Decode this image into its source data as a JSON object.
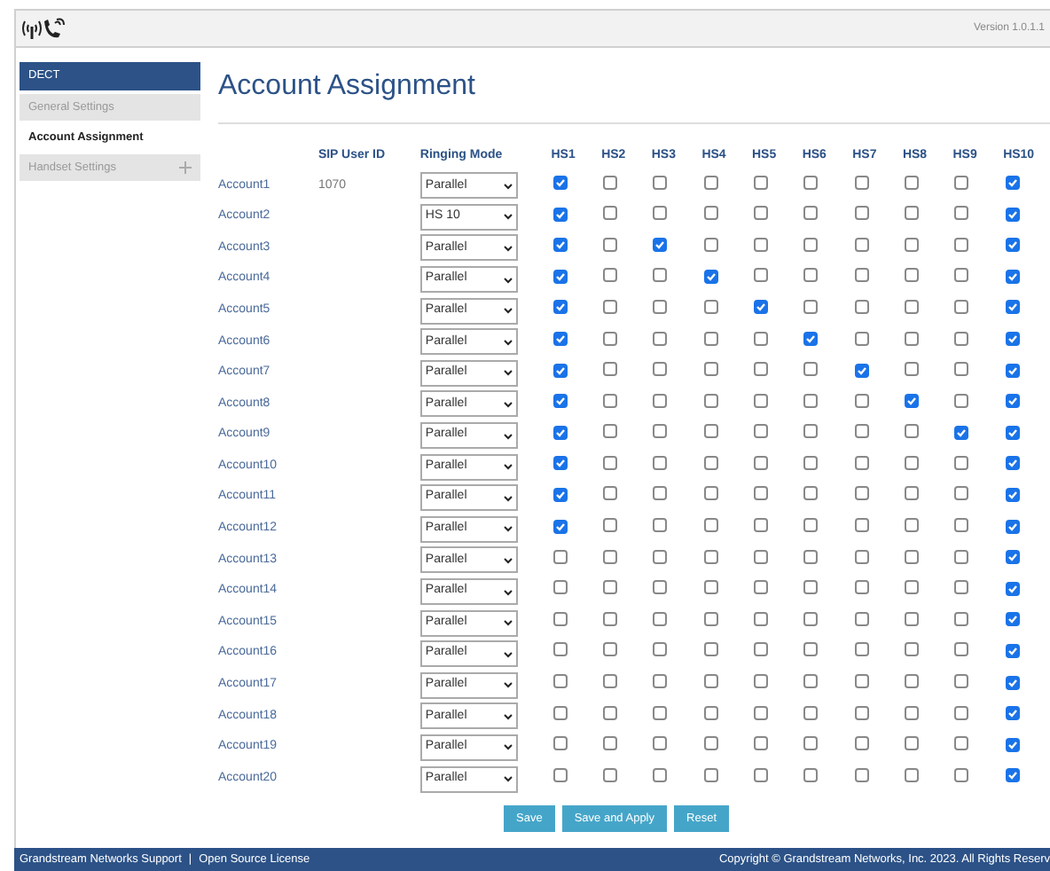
{
  "header": {
    "version": "Version 1.0.1.1"
  },
  "sidebar": {
    "section": "DECT",
    "items": [
      {
        "label": "General Settings",
        "selected": false,
        "expandable": false
      },
      {
        "label": "Account Assignment",
        "selected": true,
        "expandable": false
      },
      {
        "label": "Handset Settings",
        "selected": false,
        "expandable": true
      }
    ]
  },
  "page": {
    "title": "Account Assignment"
  },
  "table": {
    "columns": [
      "SIP User ID",
      "Ringing Mode"
    ],
    "handsets": [
      "HS1",
      "HS2",
      "HS3",
      "HS4",
      "HS5",
      "HS6",
      "HS7",
      "HS8",
      "HS9",
      "HS10"
    ],
    "rows": [
      {
        "account": "Account1",
        "sip_user_id": "1070",
        "ringing_mode": "Parallel",
        "hs": [
          true,
          false,
          false,
          false,
          false,
          false,
          false,
          false,
          false,
          true
        ]
      },
      {
        "account": "Account2",
        "ringing_mode": "HS 10",
        "hs": [
          true,
          false,
          false,
          false,
          false,
          false,
          false,
          false,
          false,
          true
        ]
      },
      {
        "account": "Account3",
        "ringing_mode": "Parallel",
        "hs": [
          true,
          false,
          true,
          false,
          false,
          false,
          false,
          false,
          false,
          true
        ]
      },
      {
        "account": "Account4",
        "ringing_mode": "Parallel",
        "hs": [
          true,
          false,
          false,
          true,
          false,
          false,
          false,
          false,
          false,
          true
        ]
      },
      {
        "account": "Account5",
        "ringing_mode": "Parallel",
        "hs": [
          true,
          false,
          false,
          false,
          true,
          false,
          false,
          false,
          false,
          true
        ]
      },
      {
        "account": "Account6",
        "ringing_mode": "Parallel",
        "hs": [
          true,
          false,
          false,
          false,
          false,
          true,
          false,
          false,
          false,
          true
        ]
      },
      {
        "account": "Account7",
        "ringing_mode": "Parallel",
        "hs": [
          true,
          false,
          false,
          false,
          false,
          false,
          true,
          false,
          false,
          true
        ]
      },
      {
        "account": "Account8",
        "ringing_mode": "Parallel",
        "hs": [
          true,
          false,
          false,
          false,
          false,
          false,
          false,
          true,
          false,
          true
        ]
      },
      {
        "account": "Account9",
        "ringing_mode": "Parallel",
        "hs": [
          true,
          false,
          false,
          false,
          false,
          false,
          false,
          false,
          true,
          true
        ]
      },
      {
        "account": "Account10",
        "ringing_mode": "Parallel",
        "hs": [
          true,
          false,
          false,
          false,
          false,
          false,
          false,
          false,
          false,
          true
        ]
      },
      {
        "account": "Account11",
        "ringing_mode": "Parallel",
        "hs": [
          true,
          false,
          false,
          false,
          false,
          false,
          false,
          false,
          false,
          true
        ]
      },
      {
        "account": "Account12",
        "ringing_mode": "Parallel",
        "hs": [
          true,
          false,
          false,
          false,
          false,
          false,
          false,
          false,
          false,
          true
        ]
      },
      {
        "account": "Account13",
        "ringing_mode": "Parallel",
        "hs": [
          false,
          false,
          false,
          false,
          false,
          false,
          false,
          false,
          false,
          true
        ]
      },
      {
        "account": "Account14",
        "ringing_mode": "Parallel",
        "hs": [
          false,
          false,
          false,
          false,
          false,
          false,
          false,
          false,
          false,
          true
        ]
      },
      {
        "account": "Account15",
        "ringing_mode": "Parallel",
        "hs": [
          false,
          false,
          false,
          false,
          false,
          false,
          false,
          false,
          false,
          true
        ]
      },
      {
        "account": "Account16",
        "ringing_mode": "Parallel",
        "hs": [
          false,
          false,
          false,
          false,
          false,
          false,
          false,
          false,
          false,
          true
        ]
      },
      {
        "account": "Account17",
        "ringing_mode": "Parallel",
        "hs": [
          false,
          false,
          false,
          false,
          false,
          false,
          false,
          false,
          false,
          true
        ]
      },
      {
        "account": "Account18",
        "ringing_mode": "Parallel",
        "hs": [
          false,
          false,
          false,
          false,
          false,
          false,
          false,
          false,
          false,
          true
        ]
      },
      {
        "account": "Account19",
        "ringing_mode": "Parallel",
        "hs": [
          false,
          false,
          false,
          false,
          false,
          false,
          false,
          false,
          false,
          true
        ]
      },
      {
        "account": "Account20",
        "ringing_mode": "Parallel",
        "hs": [
          false,
          false,
          false,
          false,
          false,
          false,
          false,
          false,
          false,
          true
        ]
      }
    ]
  },
  "buttons": [
    "Save",
    "Save and Apply",
    "Reset"
  ],
  "footer": {
    "links": [
      "Grandstream Networks Support",
      "Open Source License"
    ],
    "separator": "|",
    "copyright": "Copyright © Grandstream Networks, Inc. 2023. All Rights Reserv"
  }
}
